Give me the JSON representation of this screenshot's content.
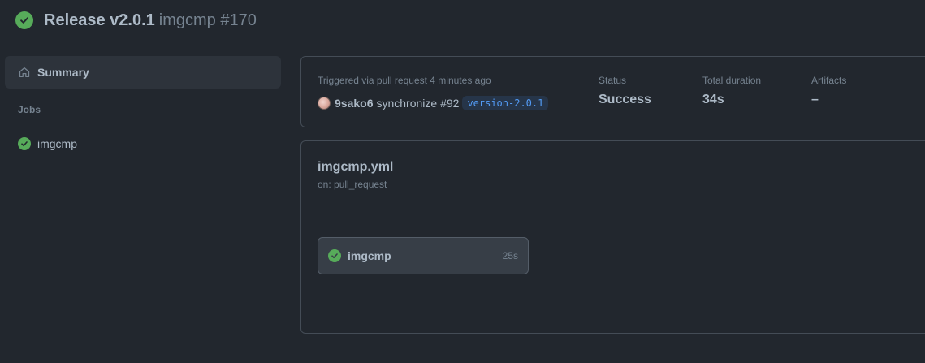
{
  "header": {
    "title": "Release v2.0.1",
    "subtitle": "imgcmp #170",
    "status_icon": "check-circle-fill-icon"
  },
  "sidebar": {
    "summary_label": "Summary",
    "summary_icon": "home-icon",
    "jobs_heading": "Jobs",
    "jobs": [
      {
        "label": "imgcmp",
        "status": "success"
      }
    ]
  },
  "run": {
    "trigger_text": "Triggered via pull request 4 minutes ago",
    "actor": "9sako6",
    "event_text": "synchronize #92",
    "branch": "version-2.0.1",
    "status_label": "Status",
    "status_value": "Success",
    "duration_label": "Total duration",
    "duration_value": "34s",
    "artifacts_label": "Artifacts",
    "artifacts_value": "–"
  },
  "workflow": {
    "file": "imgcmp.yml",
    "trigger": "on: pull_request",
    "jobs": [
      {
        "name": "imgcmp",
        "duration": "25s",
        "status": "success"
      }
    ]
  },
  "colors": {
    "background": "#22272e",
    "success": "#57ab5a",
    "text": "#adbac7",
    "muted": "#768390",
    "border": "#444c56",
    "branch_text": "#539bf5"
  }
}
